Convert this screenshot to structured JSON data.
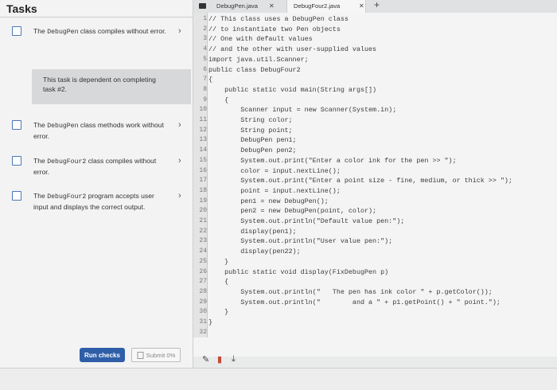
{
  "tasks": {
    "title": "Tasks",
    "items": [
      {
        "pre": "The ",
        "mono": "DebugPen",
        "post": " class compiles without error."
      },
      {
        "pre": "The ",
        "mono": "DebugPen",
        "post": " class methods work without error."
      },
      {
        "pre": "The ",
        "mono": "DebugFour2",
        "post": " class compiles without error."
      },
      {
        "pre": "The ",
        "mono": "DebugFour2",
        "post": " program accepts user input and displays the correct output."
      }
    ],
    "dependency_note": "This task is dependent on completing task #2.",
    "run_label": "Run checks",
    "submit_label": "Submit 0%"
  },
  "tabs": [
    {
      "label": "DebugPen.java"
    },
    {
      "label": "DebugFour2.java"
    }
  ],
  "code_lines": [
    {
      "n": "1",
      "t": "// This class uses a DebugPen class"
    },
    {
      "n": "2",
      "t": "// to instantiate two Pen objects"
    },
    {
      "n": "3",
      "t": "// One with default values"
    },
    {
      "n": "4",
      "t": "// and the other with user-supplied values"
    },
    {
      "n": "5",
      "t": "import java.util.Scanner;"
    },
    {
      "n": "6",
      "t": "public class DebugFour2"
    },
    {
      "n": "7",
      "t": "{"
    },
    {
      "n": "8",
      "t": "    public static void main(String args[])"
    },
    {
      "n": "9",
      "t": "    {"
    },
    {
      "n": "10",
      "t": "        Scanner input = new Scanner(System.in);"
    },
    {
      "n": "11",
      "t": "        String color;"
    },
    {
      "n": "12",
      "t": "        String point;"
    },
    {
      "n": "13",
      "t": "        DebugPen pen1;"
    },
    {
      "n": "14",
      "t": "        DebugPen pen2;"
    },
    {
      "n": "15",
      "t": "        System.out.print(\"Enter a color ink for the pen >> \");"
    },
    {
      "n": "16",
      "t": "        color = input.nextLine();"
    },
    {
      "n": "17",
      "t": "        System.out.print(\"Enter a point size - fine, medium, or thick >> \");"
    },
    {
      "n": "18",
      "t": "        point = input.nextLine();"
    },
    {
      "n": "19",
      "t": "        pen1 = new DebugPen();"
    },
    {
      "n": "20",
      "t": "        pen2 = new DebugPen(point, color);"
    },
    {
      "n": "21",
      "t": "        System.out.println(\"Default value pen:\");"
    },
    {
      "n": "22",
      "t": "        display(pen1);"
    },
    {
      "n": "23",
      "t": "        System.out.println(\"User value pen:\");"
    },
    {
      "n": "24",
      "t": "        display(pen22);"
    },
    {
      "n": "25",
      "t": "    }"
    },
    {
      "n": "26",
      "t": "    public static void display(FixDebugPen p)"
    },
    {
      "n": "27",
      "t": "    {"
    },
    {
      "n": "28",
      "t": "        System.out.println(\"   The pen has ink color \" + p.getColor());"
    },
    {
      "n": "29",
      "t": "        System.out.println(\"        and a \" + p1.getPoint() + \" point.\");"
    },
    {
      "n": "30",
      "t": "    }"
    },
    {
      "n": "31",
      "t": "}"
    },
    {
      "n": "32",
      "t": ""
    }
  ],
  "colors": {
    "accent": "#2f5ea8",
    "checkbox": "#4a78b8"
  },
  "icons": [
    "chevron-right-icon",
    "document-icon",
    "pencil-icon",
    "trash-icon",
    "download-icon",
    "plus-icon",
    "close-icon"
  ]
}
